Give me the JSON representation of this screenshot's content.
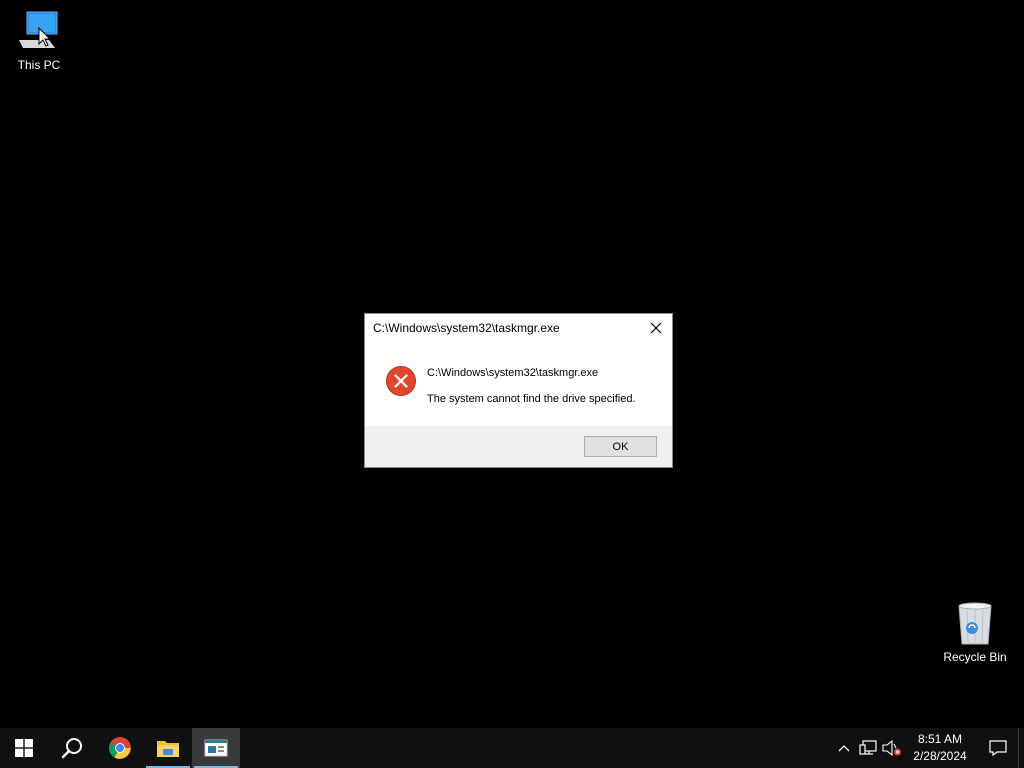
{
  "desktop": {
    "icons": [
      {
        "label": "This PC",
        "icon": "this-pc-icon"
      },
      {
        "label": "Recycle Bin",
        "icon": "recycle-bin-icon"
      }
    ]
  },
  "dialog": {
    "title": "C:\\Windows\\system32\\taskmgr.exe",
    "icon": "error-icon",
    "message_path": "C:\\Windows\\system32\\taskmgr.exe",
    "message_text": "The system cannot find the drive specified.",
    "ok_label": "OK",
    "close_icon": "close-icon"
  },
  "taskbar": {
    "items": [
      {
        "name": "start",
        "icon": "windows-start-icon"
      },
      {
        "name": "search",
        "icon": "search-icon"
      },
      {
        "name": "chrome",
        "icon": "chrome-icon"
      },
      {
        "name": "file-explorer",
        "icon": "file-explorer-icon"
      },
      {
        "name": "dialog-app",
        "icon": "app-window-icon"
      }
    ],
    "tray": {
      "icons": [
        "chevron-up-icon",
        "network-icon",
        "volume-muted-icon"
      ],
      "time": "8:51 AM",
      "date": "2/28/2024",
      "notification_icon": "action-center-icon"
    }
  },
  "colors": {
    "desktop_bg": "#000000",
    "taskbar_bg": "#101010",
    "accent": "#76b9ed",
    "error_red": "#e0462e"
  }
}
